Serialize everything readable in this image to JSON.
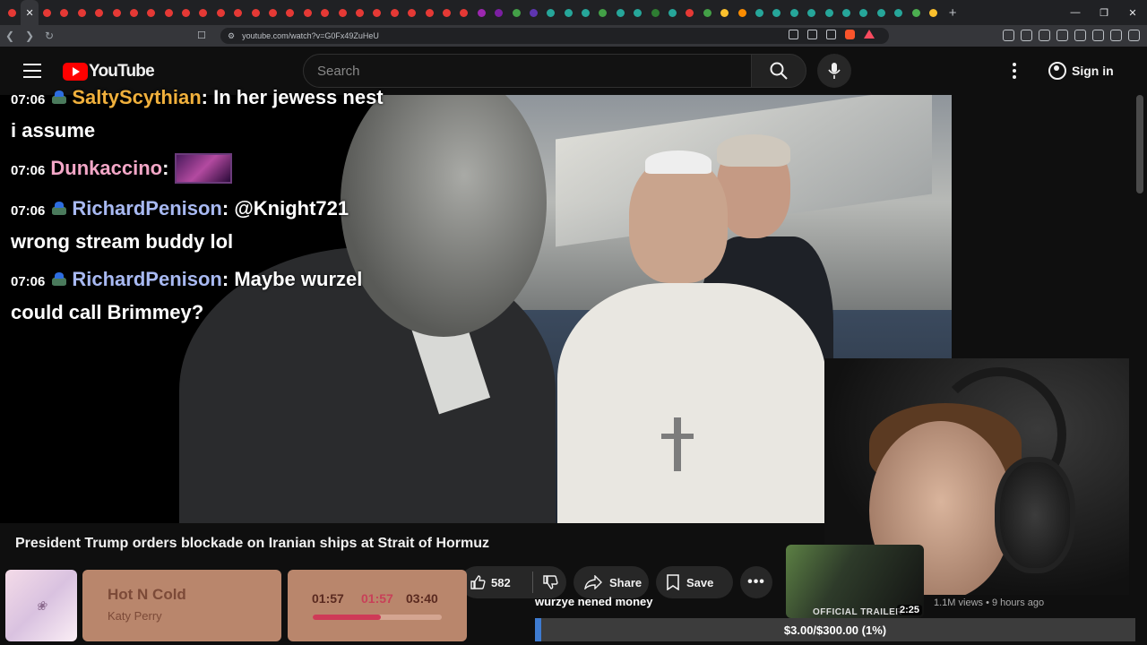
{
  "browser": {
    "url": "youtube.com/watch?v=G0Fx49ZuHeU",
    "tab_colors": [
      "#e53935",
      "#e53935",
      "#e53935",
      "#e53935",
      "#e53935",
      "#e53935",
      "#e53935",
      "#e53935",
      "#e53935",
      "#e53935",
      "#e53935",
      "#e53935",
      "#e53935",
      "#e53935",
      "#e53935",
      "#e53935",
      "#e53935",
      "#e53935",
      "#e53935",
      "#e53935",
      "#e53935",
      "#e53935",
      "#e53935",
      "#e53935",
      "#e53935",
      "#e53935",
      "#e53935",
      "#9c27b0",
      "#7b1fa2",
      "#43a047",
      "#5e35b1",
      "#26a69a",
      "#26a69a",
      "#26a69a",
      "#43a047",
      "#26a69a",
      "#26a69a",
      "#2e7d32",
      "#26a69a",
      "#e53935",
      "#43a047",
      "#fbc02d",
      "#fb8c00",
      "#26a69a",
      "#26a69a",
      "#26a69a",
      "#26a69a",
      "#26a69a",
      "#26a69a",
      "#26a69a",
      "#26a69a",
      "#26a69a",
      "#4caf50",
      "#fbc02d"
    ],
    "active_tab_index": 1,
    "new_tab_label": "+"
  },
  "header": {
    "logo_text": "YouTube",
    "search_placeholder": "Search",
    "sign_in_label": "Sign in"
  },
  "chat": [
    {
      "time": "07:06",
      "user": "SaltyScythian",
      "color": "#f0b03c",
      "text": "In her jewess nest i assume",
      "has_badge": true
    },
    {
      "time": "07:06",
      "user": "Dunkaccino",
      "color": "#f3a7c7",
      "text": "",
      "has_emote": true
    },
    {
      "time": "07:06",
      "user": "RichardPenison",
      "color": "#a8b9f2",
      "text": "@Knight721 wrong stream buddy lol",
      "has_badge": true
    },
    {
      "time": "07:06",
      "user": "RichardPenison",
      "color": "#a8b9f2",
      "text": "Maybe wurzel could call Brimmey?",
      "has_badge": true
    }
  ],
  "video": {
    "title": "President Trump orders blockade on Iranian ships at Strait of Hormuz",
    "likes": "582",
    "share_label": "Share",
    "save_label": "Save"
  },
  "recommended": {
    "duration": "2:25",
    "views": "1.1M views",
    "age": "9 hours ago",
    "thumb_text": "OFFICIAL TRAILER"
  },
  "donation": {
    "message": "wurzye nened money",
    "goal_text": "$3.00/$300.00 (1%)",
    "progress": 0.01,
    "color": "#3e7bd0"
  },
  "music": {
    "song": "Hot N Cold",
    "artist": "Katy Perry",
    "elapsed": "01:57",
    "middle": "01:57",
    "total": "03:40",
    "progress": 0.53,
    "accent": "#cf3a57"
  }
}
